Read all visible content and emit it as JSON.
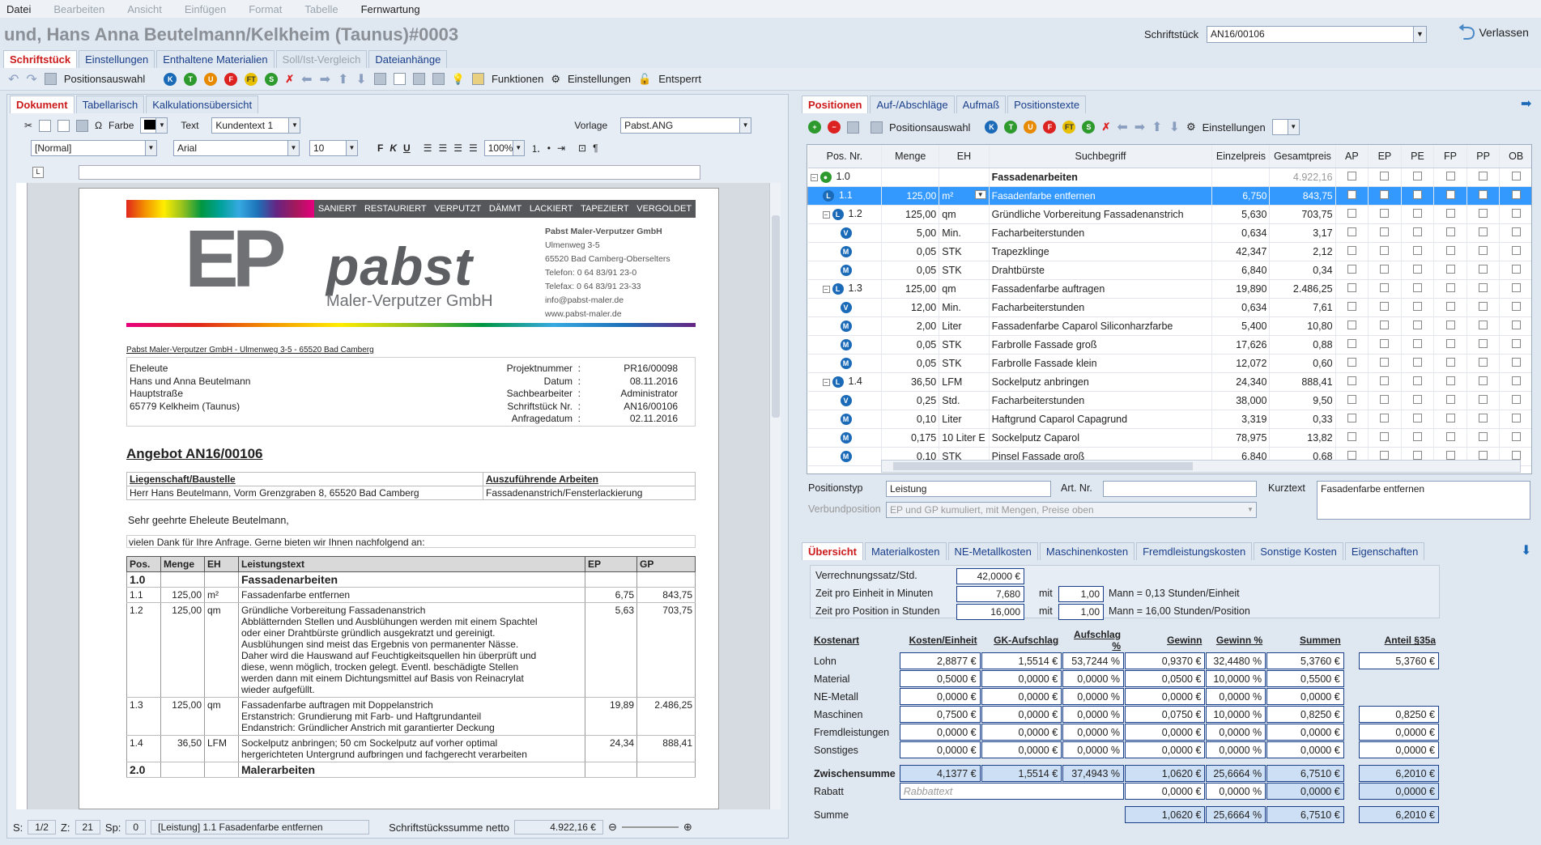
{
  "menu": {
    "datei": "Datei",
    "bearbeiten": "Bearbeiten",
    "ansicht": "Ansicht",
    "einfuegen": "Einfügen",
    "format": "Format",
    "tabelle": "Tabelle",
    "fernwartung": "Fernwartung"
  },
  "header": {
    "title": "und, Hans Anna Beutelmann/Kelkheim (Taunus)#0003",
    "schriftstueck_label": "Schriftstück",
    "schriftstueck_value": "AN16/00106",
    "leave": "Verlassen"
  },
  "main_tabs": [
    "Schriftstück",
    "Einstellungen",
    "Enthaltene Materialien",
    "Soll/Ist-Vergleich",
    "Dateianhänge"
  ],
  "toolbar": {
    "positionsauswahl": "Positionsauswahl",
    "funktionen": "Funktionen",
    "einstellungen": "Einstellungen",
    "entsperrt": "Entsperrt"
  },
  "doc_tabs": [
    "Dokument",
    "Tabellarisch",
    "Kalkulationsübersicht"
  ],
  "format": {
    "farbe": "Farbe",
    "text": "Text",
    "text_value": "Kundentext 1",
    "vorlage": "Vorlage",
    "vorlage_value": "Pabst.ANG",
    "style": "[Normal]",
    "font": "Arial",
    "size": "10",
    "zoom": "100%"
  },
  "letter": {
    "banner": [
      "SANIERT",
      "RESTAURIERT",
      "VERPUTZT",
      "DÄMMT",
      "LACKIERT",
      "TAPEZIERT",
      "VERGOLDET"
    ],
    "logo_ep": "EP",
    "logo_pabst": "pabst",
    "logo_sub": "Maler-Verputzer GmbH",
    "company": [
      "Pabst Maler-Verputzer GmbH",
      "Ulmenweg 3-5",
      "65520 Bad Camberg-Oberselters",
      "Telefon: 0 64 83/91 23-0",
      "Telefax: 0 64 83/91 23-33",
      "info@pabst-maler.de",
      "www.pabst-maler.de"
    ],
    "sender": "Pabst Maler-Verputzer GmbH - Ulmenweg 3-5 - 65520 Bad Camberg",
    "recipient": [
      "Eheleute",
      "Hans und Anna Beutelmann",
      "Hauptstraße",
      "65779 Kelkheim (Taunus)"
    ],
    "meta": [
      [
        "Projektnummer",
        ":",
        "PR16/00098"
      ],
      [
        "Datum",
        ":",
        "08.11.2016"
      ],
      [
        "Sachbearbeiter",
        ":",
        "Administrator"
      ],
      [
        "Schriftstück Nr.",
        ":",
        "AN16/00106"
      ],
      [
        "Anfragedatum",
        ":",
        "02.11.2016"
      ]
    ],
    "angebot": "Angebot AN16/00106",
    "lieg_head": "Liegenschaft/Baustelle",
    "arbeit_head": "Auszuführende Arbeiten",
    "lieg_val": "Herr Hans Beutelmann, Vorm Grenzgraben 8, 65520 Bad Camberg",
    "arbeit_val": "Fassadenanstrich/Fensterlackierung",
    "greeting": "Sehr geehrte Eheleute Beutelmann,",
    "thanks": "vielen Dank für Ihre Anfrage. Gerne bieten wir Ihnen nachfolgend an:",
    "table_head": [
      "Pos.",
      "Menge",
      "EH",
      "Leistungstext",
      "EP",
      "GP"
    ],
    "group1": [
      "1.0",
      "Fassadenarbeiten"
    ],
    "items": [
      {
        "pos": "1.1",
        "menge": "125,00",
        "eh": "m²",
        "text": [
          "Fassadenfarbe entfernen"
        ],
        "ep": "6,75",
        "gp": "843,75"
      },
      {
        "pos": "1.2",
        "menge": "125,00",
        "eh": "qm",
        "text": [
          "Gründliche Vorbereitung Fassadenanstrich",
          "Abblätternden Stellen und Ausblühungen werden mit einem Spachtel",
          "oder einer Drahtbürste gründlich ausgekratzt und gereinigt.",
          "Ausblühungen sind meist das Ergebnis von permanenter Nässe.",
          "Daher wird die Hauswand auf Feuchtigkeitsquellen hin überprüft und",
          "diese, wenn möglich, trocken gelegt. Eventl. beschädigte Stellen",
          "werden dann mit einem Dichtungsmittel auf Basis von Reinacrylat",
          "wieder aufgefüllt."
        ],
        "ep": "5,63",
        "gp": "703,75"
      },
      {
        "pos": "1.3",
        "menge": "125,00",
        "eh": "qm",
        "text": [
          "Fassadenfarbe auftragen mit Doppelanstrich",
          "Erstanstrich: Grundierung mit Farb- und Haftgrundanteil",
          "Endanstrich: Gründlicher Anstrich mit garantierter Deckung"
        ],
        "ep": "19,89",
        "gp": "2.486,25"
      },
      {
        "pos": "1.4",
        "menge": "36,50",
        "eh": "LFM",
        "text": [
          "Sockelputz anbringen; 50 cm Sockelputz auf vorher optimal",
          "hergerichteten Untergrund aufbringen und fachgerecht verarbeiten"
        ],
        "ep": "24,34",
        "gp": "888,41"
      }
    ],
    "group2": [
      "2.0",
      "Malerarbeiten"
    ]
  },
  "status": {
    "s_label": "S:",
    "s_value": "1/2",
    "z_label": "Z:",
    "z_value": "21",
    "sp_label": "Sp:",
    "sp_value": "0",
    "position": "[Leistung]  1.1 Fasadenfarbe entfernen",
    "summe_label": "Schriftstückssumme netto",
    "summe_value": "4.922,16 €"
  },
  "right_tabs": [
    "Positionen",
    "Auf-/Abschläge",
    "Aufmaß",
    "Positionstexte"
  ],
  "right_toolbar": {
    "positionsauswahl": "Positionsauswahl",
    "einstellungen": "Einstellungen"
  },
  "grid": {
    "head": [
      "Pos. Nr.",
      "Menge",
      "EH",
      "Suchbegriff",
      "Einzelpreis",
      "Gesamtpreis",
      "AP",
      "EP",
      "PE",
      "FP",
      "PP",
      "OB"
    ],
    "rows": [
      {
        "pos": "1.0",
        "menge": "",
        "eh": "",
        "such": "Fassadenarbeiten",
        "ep": "",
        "gp": "4.922,16",
        "type": "group"
      },
      {
        "pos": "1.1",
        "menge": "125,00",
        "eh": "m²",
        "such": "Fasadenfarbe entfernen",
        "ep": "6,750",
        "gp": "843,75",
        "type": "sel"
      },
      {
        "pos": "1.2",
        "menge": "125,00",
        "eh": "qm",
        "such": "Gründliche Vorbereitung Fassadenanstrich",
        "ep": "5,630",
        "gp": "703,75",
        "type": "L"
      },
      {
        "pos": "",
        "menge": "5,00",
        "eh": "Min.",
        "such": "Facharbeiterstunden",
        "ep": "0,634",
        "gp": "3,17",
        "type": "V"
      },
      {
        "pos": "",
        "menge": "0,05",
        "eh": "STK",
        "such": "Trapezklinge",
        "ep": "42,347",
        "gp": "2,12",
        "type": "M"
      },
      {
        "pos": "",
        "menge": "0,05",
        "eh": "STK",
        "such": "Drahtbürste",
        "ep": "6,840",
        "gp": "0,34",
        "type": "M"
      },
      {
        "pos": "1.3",
        "menge": "125,00",
        "eh": "qm",
        "such": "Fassadenfarbe auftragen",
        "ep": "19,890",
        "gp": "2.486,25",
        "type": "L"
      },
      {
        "pos": "",
        "menge": "12,00",
        "eh": "Min.",
        "such": "Facharbeiterstunden",
        "ep": "0,634",
        "gp": "7,61",
        "type": "V"
      },
      {
        "pos": "",
        "menge": "2,00",
        "eh": "Liter",
        "such": "Fassadenfarbe Caparol Siliconharzfarbe",
        "ep": "5,400",
        "gp": "10,80",
        "type": "M"
      },
      {
        "pos": "",
        "menge": "0,05",
        "eh": "STK",
        "such": "Farbrolle Fassade groß",
        "ep": "17,626",
        "gp": "0,88",
        "type": "M"
      },
      {
        "pos": "",
        "menge": "0,05",
        "eh": "STK",
        "such": "Farbrolle Fassade klein",
        "ep": "12,072",
        "gp": "0,60",
        "type": "M"
      },
      {
        "pos": "1.4",
        "menge": "36,50",
        "eh": "LFM",
        "such": "Sockelputz anbringen",
        "ep": "24,340",
        "gp": "888,41",
        "type": "L"
      },
      {
        "pos": "",
        "menge": "0,25",
        "eh": "Std.",
        "such": "Facharbeiterstunden",
        "ep": "38,000",
        "gp": "9,50",
        "type": "V"
      },
      {
        "pos": "",
        "menge": "0,10",
        "eh": "Liter",
        "such": "Haftgrund Caparol Capagrund",
        "ep": "3,319",
        "gp": "0,33",
        "type": "M"
      },
      {
        "pos": "",
        "menge": "0,175",
        "eh": "10 Liter E",
        "such": "Sockelputz Caparol",
        "ep": "78,975",
        "gp": "13,82",
        "type": "M"
      },
      {
        "pos": "",
        "menge": "0,10",
        "eh": "STK",
        "such": "Pinsel Fassade groß",
        "ep": "6,840",
        "gp": "0,68",
        "type": "M"
      }
    ]
  },
  "detail": {
    "positionstyp_label": "Positionstyp",
    "positionstyp_value": "Leistung",
    "artnr_label": "Art. Nr.",
    "artnr_value": "",
    "kurztext_label": "Kurztext",
    "kurztext_value": "Fasadenfarbe entfernen",
    "verbund_label": "Verbundposition",
    "verbund_value": "EP und GP kumuliert, mit Mengen, Preise oben"
  },
  "bottom_tabs": [
    "Übersicht",
    "Materialkosten",
    "NE-Metallkosten",
    "Maschinenkosten",
    "Fremdleistungskosten",
    "Sonstige Kosten",
    "Eigenschaften"
  ],
  "overview": {
    "vs_label": "Verrechnungssatz/Std.",
    "vs_value": "42,0000 €",
    "zpe_label": "Zeit pro Einheit in Minuten",
    "zpe_value": "7,680",
    "zpe_mit": "mit",
    "zpe_mann": "1,00",
    "zpe_text": "Mann = 0,13 Stunden/Einheit",
    "zpp_label": "Zeit pro Position in Stunden",
    "zpp_value": "16,000",
    "zpp_mit": "mit",
    "zpp_mann": "1,00",
    "zpp_text": "Mann = 16,00 Stunden/Position"
  },
  "kosten": {
    "head": [
      "Kostenart",
      "Kosten/Einheit",
      "GK-Aufschlag",
      "Aufschlag %",
      "Gewinn",
      "Gewinn %",
      "Summen",
      "Anteil §35a"
    ],
    "rows": [
      [
        "Lohn",
        "2,8877 €",
        "1,5514 €",
        "53,7244 %",
        "0,9370 €",
        "32,4480 %",
        "5,3760 €",
        "5,3760 €"
      ],
      [
        "Material",
        "0,5000 €",
        "0,0000 €",
        "0,0000 %",
        "0,0500 €",
        "10,0000 %",
        "0,5500 €",
        ""
      ],
      [
        "NE-Metall",
        "0,0000 €",
        "0,0000 €",
        "0,0000 %",
        "0,0000 €",
        "0,0000 %",
        "0,0000 €",
        ""
      ],
      [
        "Maschinen",
        "0,7500 €",
        "0,0000 €",
        "0,0000 %",
        "0,0750 €",
        "10,0000 %",
        "0,8250 €",
        "0,8250 €"
      ],
      [
        "Fremdleistungen",
        "0,0000 €",
        "0,0000 €",
        "0,0000 %",
        "0,0000 €",
        "0,0000 %",
        "0,0000 €",
        "0,0000 €"
      ],
      [
        "Sonstiges",
        "0,0000 €",
        "0,0000 €",
        "0,0000 %",
        "0,0000 €",
        "0,0000 %",
        "0,0000 €",
        "0,0000 €"
      ]
    ],
    "zwischen": [
      "Zwischensumme",
      "4,1377 €",
      "1,5514 €",
      "37,4943 %",
      "1,0620 €",
      "25,6664 %",
      "6,7510 €",
      "6,2010 €"
    ],
    "rabatt": [
      "Rabatt",
      "Rabbattext",
      "0,0000 €",
      "0,0000 %",
      "0,0000 €",
      "0,0000 €"
    ],
    "summe": [
      "Summe",
      "1,0620 €",
      "25,6664 %",
      "6,7510 €",
      "6,2010 €"
    ]
  }
}
